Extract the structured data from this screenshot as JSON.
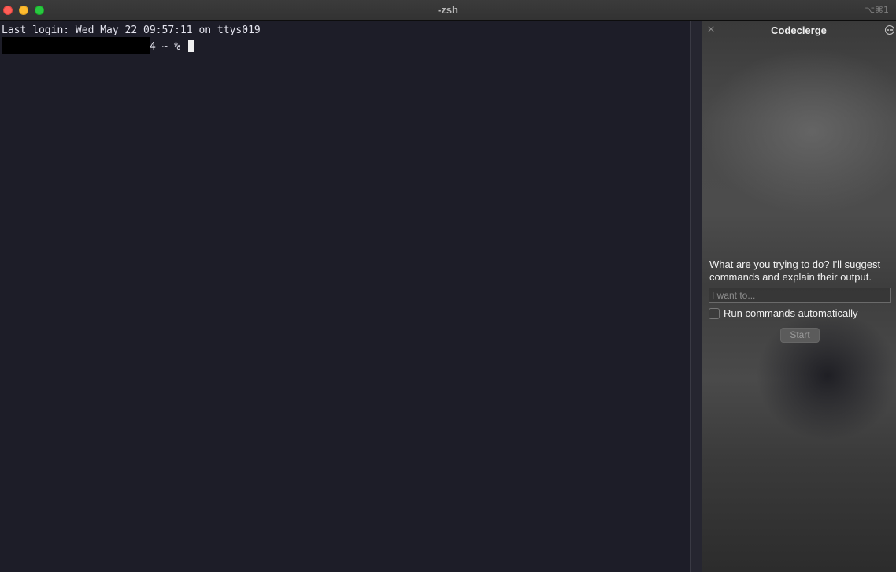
{
  "window": {
    "title": "-zsh",
    "shortcut": "⌥⌘1"
  },
  "terminal": {
    "last_login": "Last login: Wed May 22 09:57:11 on ttys019",
    "prompt_suffix": "4 ~ % "
  },
  "panel": {
    "title": "Codecierge",
    "close_icon": "×",
    "description": "What are you trying to do? I'll suggest commands and explain their output.",
    "input_placeholder": "I want to...",
    "input_value": "",
    "checkbox_label": "Run commands automatically",
    "checkbox_checked": false,
    "start_label": "Start"
  },
  "icons": {
    "panel_close": "close-icon",
    "panel_more": "more-options-icon"
  },
  "colors": {
    "close": "#fe5f57",
    "minimize": "#febc2e",
    "zoom": "#28c840",
    "terminal_bg": "#1d1d28"
  }
}
